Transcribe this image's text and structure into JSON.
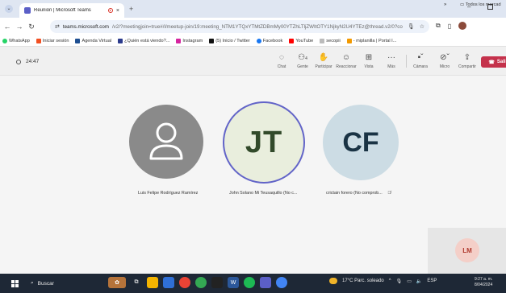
{
  "browser": {
    "tab_title": "Reunión | Microsoft Teams",
    "tab_close": "×",
    "new_tab": "+",
    "url_host": "teams.microsoft.com",
    "url_path": "/v2/?meetingjoin=true#/l/meetup-join/19:meeting_NTM1YTQxYTMtZDBmMy00YTZhLTljZWItOTY1NjkyN2U4YTEz@thread.v2/0?conte..."
  },
  "bookmarks": [
    {
      "label": "WhatsApp",
      "color": "#25d366"
    },
    {
      "label": "Iniciar sesión",
      "color": "#f25022"
    },
    {
      "label": "Agenda Virtual",
      "color": "#1e4f91"
    },
    {
      "label": "¿Quién está viendo?...",
      "color": "#2b3a8c"
    },
    {
      "label": "Instagram",
      "color": "#d6249f"
    },
    {
      "label": "(5) Inicio / Twitter",
      "color": "#111111"
    },
    {
      "label": "Facebook",
      "color": "#1877f2"
    },
    {
      "label": "YouTube",
      "color": "#ff0000"
    },
    {
      "label": "secopii",
      "color": "#bbbbbb"
    },
    {
      "label": "- miplanilla | Portal I...",
      "color": "#f29900"
    }
  ],
  "bookmarks_more": "»",
  "bookmarks_folder": "Todos los marcad",
  "meeting": {
    "timer": "24:47",
    "controls": {
      "chat": "Chat",
      "people": "Gente",
      "people_count": "4",
      "raise": "Participar",
      "react": "Reaccionar",
      "view": "Vista",
      "more": "Más",
      "camera": "Cámara",
      "mic": "Micro",
      "share": "Compartir",
      "leave": "Sali"
    }
  },
  "participants": [
    {
      "initials": "",
      "name": "Luis Felipe Rodríguez Ramírez"
    },
    {
      "initials": "JT",
      "name": "John Solano Mi Teusaquillo (No c..."
    },
    {
      "initials": "CF",
      "name": "crictain forero (No comprob..."
    }
  ],
  "self": {
    "initials": "LM"
  },
  "taskbar": {
    "search": "Buscar",
    "weather": "17°C Parc. soleado",
    "lang": "ESP",
    "time": "9:27 a. m.",
    "date": "8/04/2024"
  }
}
